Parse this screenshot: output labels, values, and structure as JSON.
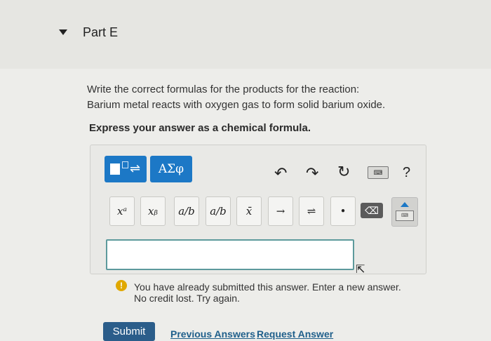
{
  "part": {
    "title": "Part E"
  },
  "question": {
    "line1": "Write the correct formulas for the products for the reaction:",
    "line2": "Barium metal reacts with oxygen gas to form solid barium oxide.",
    "instruction": "Express your answer as a chemical formula."
  },
  "editor": {
    "greek_label": "ΑΣφ",
    "help_label": "?",
    "buttons": [
      {
        "name": "superscript-button",
        "label": "xᵃ"
      },
      {
        "name": "subscript-button",
        "label": "xᵦ"
      },
      {
        "name": "fraction-button",
        "label": "a/b"
      },
      {
        "name": "fraction-line-button",
        "label": "a/b"
      },
      {
        "name": "mean-button",
        "label": "x̄"
      },
      {
        "name": "arrow-button",
        "label": "→"
      },
      {
        "name": "equilibrium-button",
        "label": "⇌"
      },
      {
        "name": "dot-button",
        "label": "•"
      }
    ],
    "answer_value": ""
  },
  "feedback": {
    "line1": "You have already submitted this answer. Enter a new answer.",
    "line2": "No credit lost. Try again."
  },
  "actions": {
    "submit": "Submit",
    "previous": "Previous Answers",
    "request": "Request Answer"
  },
  "colors": {
    "accent": "#1c78c6",
    "warning": "#e0a800",
    "submit": "#2b5d8a"
  }
}
